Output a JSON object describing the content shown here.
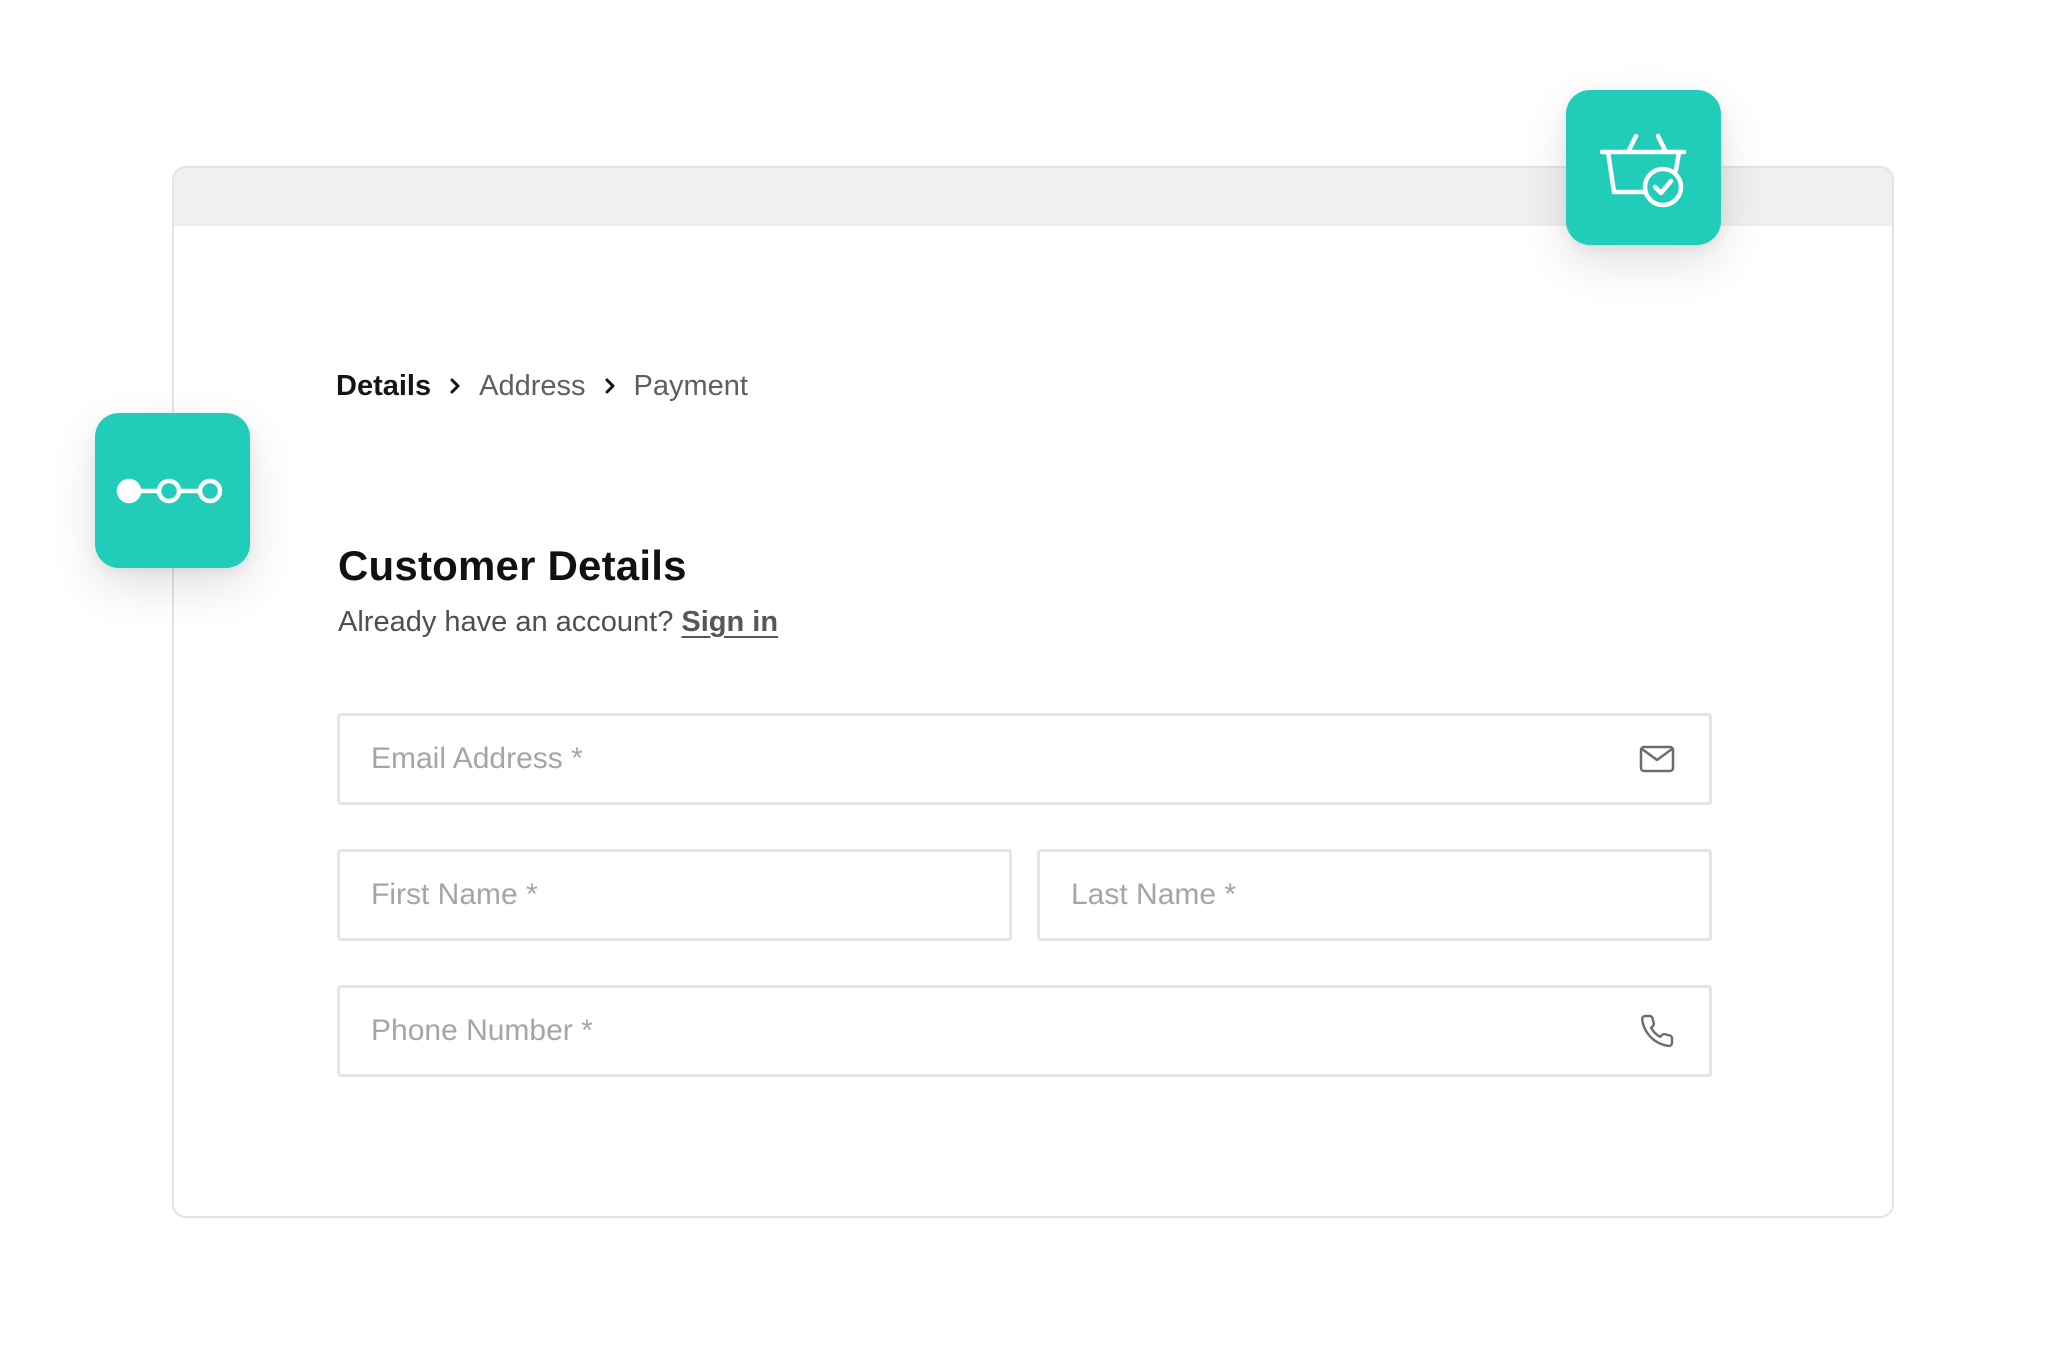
{
  "breadcrumb": {
    "steps": [
      {
        "label": "Details",
        "active": true
      },
      {
        "label": "Address",
        "active": false
      },
      {
        "label": "Payment",
        "active": false
      }
    ]
  },
  "form": {
    "title": "Customer Details",
    "account_prompt": "Already have an account?",
    "signin_label": "Sign in",
    "fields": {
      "email": {
        "placeholder": "Email Address *",
        "value": "",
        "icon": "mail-icon"
      },
      "first_name": {
        "placeholder": "First Name *",
        "value": ""
      },
      "last_name": {
        "placeholder": "Last Name *",
        "value": ""
      },
      "phone": {
        "placeholder": "Phone Number *",
        "value": "",
        "icon": "phone-icon"
      }
    }
  },
  "badges": {
    "basket": {
      "icon": "shopping-basket-check-icon"
    },
    "steps": {
      "icon": "progress-steps-icon"
    }
  },
  "colors": {
    "accent": "#21cdb8",
    "window_bar": "#eff0f1",
    "border": "#e3e4e6",
    "text_primary": "#111111",
    "text_secondary": "#5d5f63",
    "placeholder": "#a3a5a8"
  }
}
